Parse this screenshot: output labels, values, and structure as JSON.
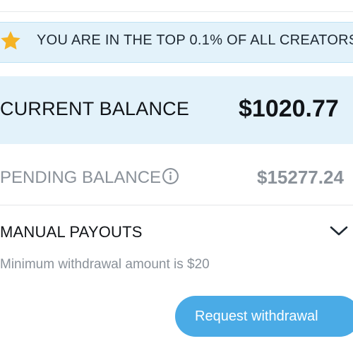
{
  "banner": {
    "icon": "star-icon",
    "text": "YOU ARE IN THE TOP 0.1% OF ALL CREATORS!"
  },
  "current_balance": {
    "label": "CURRENT BALANCE",
    "value": "$1020.77"
  },
  "pending_balance": {
    "label": "PENDING BALANCE",
    "icon": "info-icon",
    "value": "$15277.24"
  },
  "manual_payouts": {
    "title": "MANUAL PAYOUTS",
    "icon": "chevron-down-icon",
    "note": "Minimum withdrawal amount is $20"
  },
  "actions": {
    "request_withdrawal": "Request withdrawal"
  },
  "colors": {
    "accent": "#4aabe6",
    "highlight_bg": "#e3f2fa",
    "star": "#f5b324",
    "muted_text": "#8a9199"
  }
}
